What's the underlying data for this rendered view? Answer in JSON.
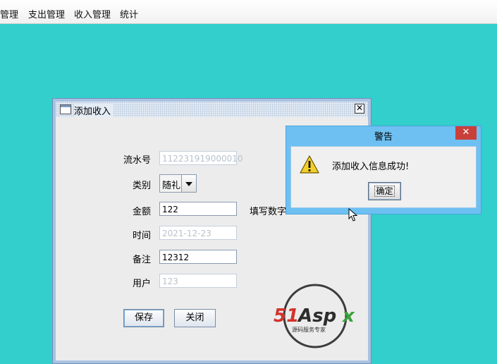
{
  "menubar": {
    "items": [
      "管理",
      "支出管理",
      "收入管理",
      "统计"
    ]
  },
  "frame": {
    "title": "添加收入",
    "fields": {
      "serial": {
        "label": "流水号",
        "value": "112231919000010"
      },
      "category": {
        "label": "类别",
        "value": "随礼"
      },
      "amount": {
        "label": "金额",
        "value": "122",
        "hint": "填写数字"
      },
      "time": {
        "label": "时间",
        "value": "2021-12-23"
      },
      "note": {
        "label": "备注",
        "value": "12312"
      },
      "user": {
        "label": "用户",
        "value": "123"
      }
    },
    "save_label": "保存",
    "close_label": "关闭"
  },
  "logo": {
    "brand": "51Aspx",
    "tagline": "源码服务专家"
  },
  "dialog": {
    "title": "警告",
    "close_glyph": "✕",
    "message": "添加收入信息成功!",
    "ok_label": "确定"
  },
  "colors": {
    "desktop": "#32cfcc",
    "dialog_frame": "#6ec0f2",
    "close_red": "#c9403a"
  }
}
